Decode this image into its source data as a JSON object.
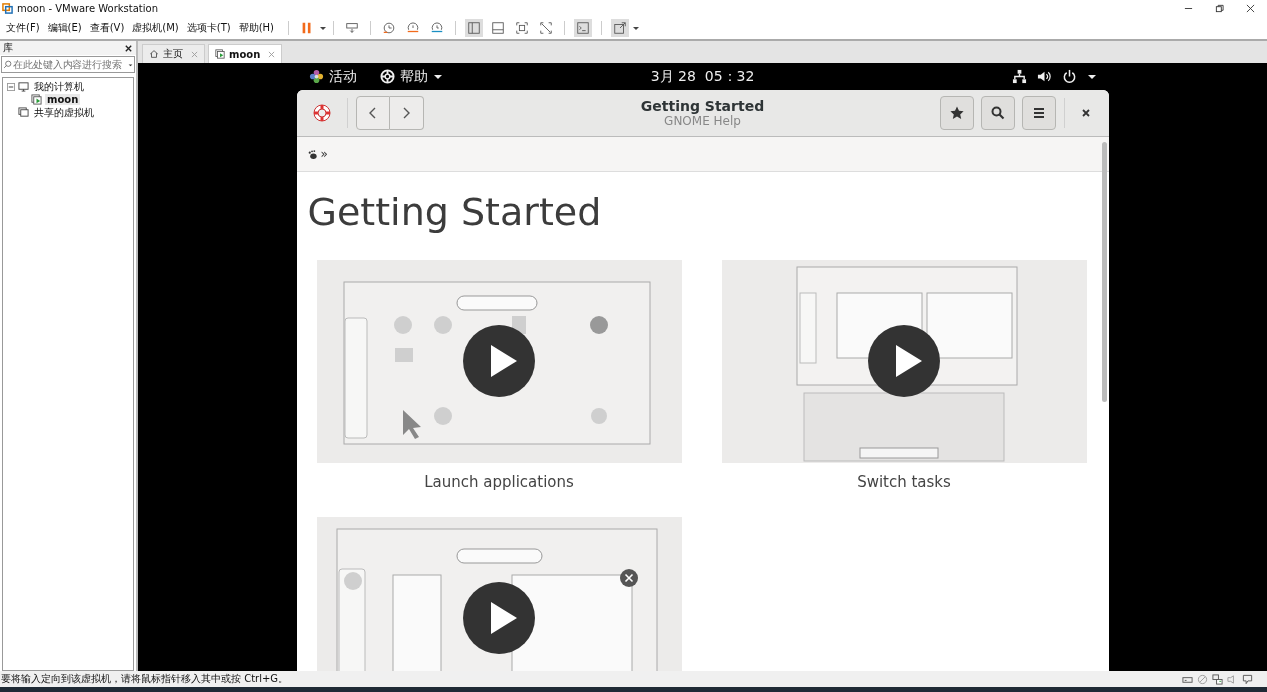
{
  "window": {
    "title": "moon - VMware Workstation"
  },
  "menu": [
    "文件(F)",
    "编辑(E)",
    "查看(V)",
    "虚拟机(M)",
    "选项卡(T)",
    "帮助(H)"
  ],
  "library": {
    "title": "库",
    "search": {
      "placeholder": "在此处键入内容进行搜索"
    },
    "tree": [
      {
        "label": "我的计算机",
        "expanded": true,
        "selected": false,
        "children": [
          {
            "label": "moon",
            "selected": true
          }
        ]
      },
      {
        "label": "共享的虚拟机",
        "selected": false
      }
    ]
  },
  "tabs": [
    {
      "label": "主页",
      "selected": false,
      "kind": "home"
    },
    {
      "label": "moon",
      "selected": true,
      "kind": "vm"
    }
  ],
  "guest": {
    "top_bar": {
      "activities": "活动",
      "app_menu": "帮助",
      "clock": "3月 28  05：32"
    },
    "help_window": {
      "title": "Getting Started",
      "subtitle": "GNOME Help",
      "breadcrumb": "»",
      "heading": "Getting Started",
      "topics": [
        {
          "kind": "apps",
          "caption": "Launch applications"
        },
        {
          "kind": "keyboard",
          "caption": "Switch tasks"
        },
        {
          "kind": "windows",
          "dismiss": true
        }
      ]
    }
  },
  "status_bar": {
    "message": "要将输入定向到该虚拟机，请将鼠标指针移入其中或按 Ctrl+G。"
  }
}
